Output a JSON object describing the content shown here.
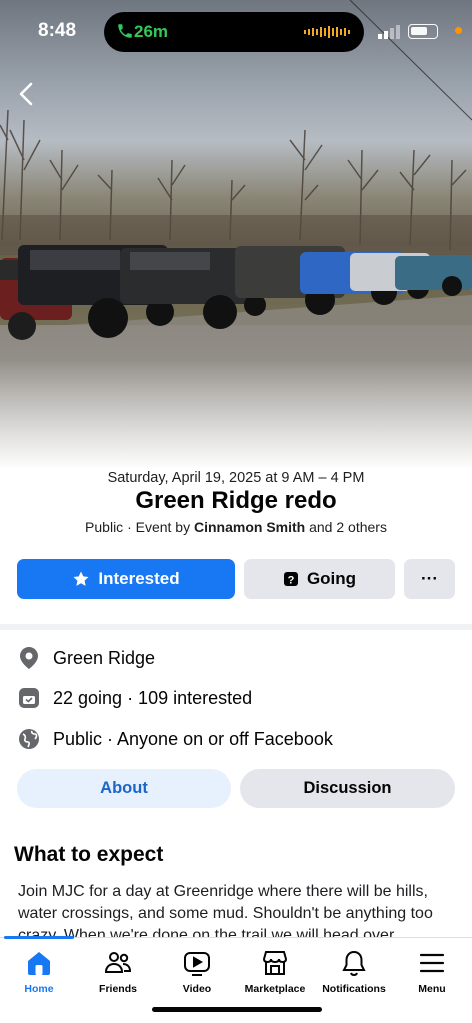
{
  "status_bar": {
    "time": "8:48",
    "call_duration": "26m"
  },
  "event": {
    "date_time": "Saturday, April 19, 2025 at 9 AM – 4 PM",
    "title": "Green Ridge redo",
    "visibility_prefix": "Public · Event by ",
    "host": "Cinnamon Smith",
    "host_suffix": " and 2 others"
  },
  "actions": {
    "interested_label": "Interested",
    "going_label": "Going",
    "more_label": "···"
  },
  "details": {
    "location": "Green Ridge",
    "attendance": "22 going · 109 interested",
    "privacy": "Public · Anyone on or off Facebook"
  },
  "tabs": [
    {
      "label": "About",
      "selected": true
    },
    {
      "label": "Discussion",
      "selected": false
    }
  ],
  "about": {
    "section_title": "What to expect",
    "description": "Join MJC for a day at Greenridge where there will be hills, water crossings, and some mud. Shouldn't be anything too crazy. When we're done on the trail we will head over"
  },
  "bottom_nav": {
    "items": [
      {
        "label": "Home",
        "icon": "home-icon",
        "active": true
      },
      {
        "label": "Friends",
        "icon": "friends-icon",
        "active": false
      },
      {
        "label": "Video",
        "icon": "video-icon",
        "active": false
      },
      {
        "label": "Marketplace",
        "icon": "marketplace-icon",
        "active": false
      },
      {
        "label": "Notifications",
        "icon": "bell-icon",
        "active": false
      },
      {
        "label": "Menu",
        "icon": "menu-icon",
        "active": false
      }
    ]
  },
  "colors": {
    "accent": "#1877f2",
    "button_gray": "#e4e6eb",
    "about_tab_bg": "#e7f0fd",
    "call_green": "#34c759"
  }
}
